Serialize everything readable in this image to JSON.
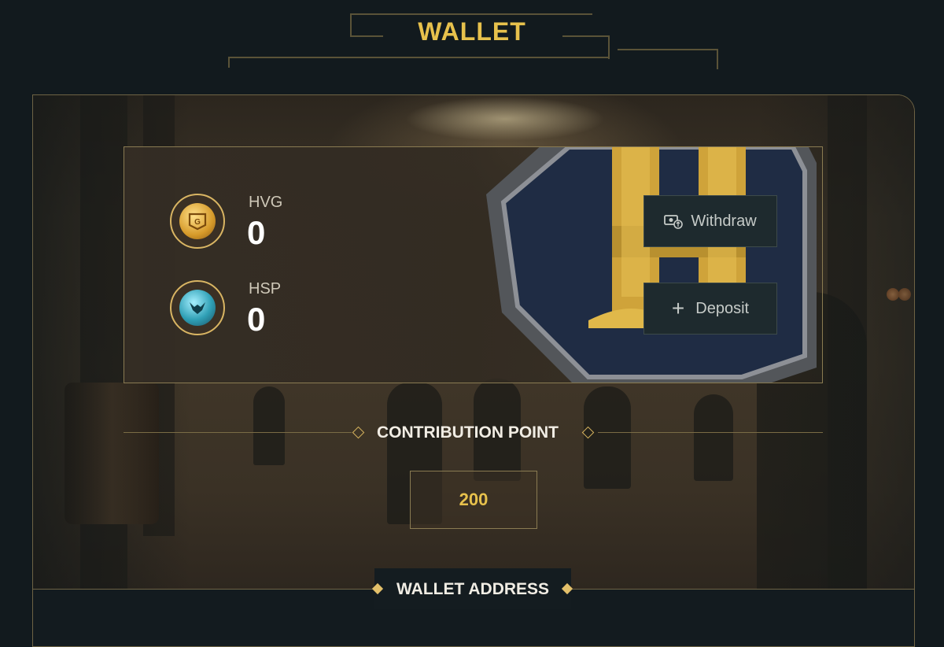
{
  "page": {
    "title": "WALLET"
  },
  "tokens": [
    {
      "symbol": "HVG",
      "balance": "0"
    },
    {
      "symbol": "HSP",
      "balance": "0"
    }
  ],
  "actions": {
    "withdraw_label": "Withdraw",
    "deposit_label": "Deposit"
  },
  "contribution": {
    "heading": "CONTRIBUTION POINT",
    "value": "200"
  },
  "wallet_address": {
    "heading": "WALLET ADDRESS"
  },
  "icons": {
    "hvg": "hvg-coin-icon",
    "hsp": "hsp-coin-icon",
    "withdraw": "cash-exchange-icon",
    "deposit": "plus-icon"
  },
  "colors": {
    "accent_gold": "#e7c14c",
    "background": "#121a1e",
    "border_gold": "#8a7b52",
    "button_bg": "#1e2a2e"
  }
}
